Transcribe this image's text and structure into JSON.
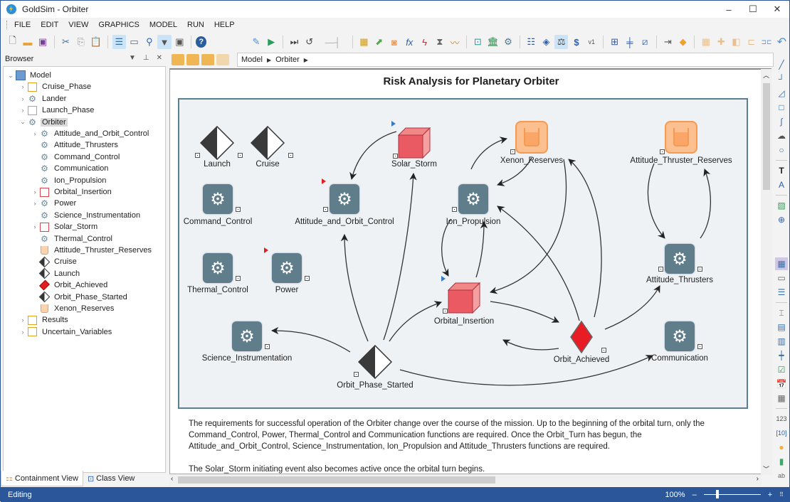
{
  "window": {
    "title": "GoldSim  - Orbiter",
    "controls": {
      "minimize": "–",
      "maximize": "☐",
      "close": "✕"
    }
  },
  "menu": [
    "FILE",
    "EDIT",
    "VIEW",
    "GRAPHICS",
    "MODEL",
    "RUN",
    "HELP"
  ],
  "toolbar": {
    "icons": [
      "new-file-icon",
      "open-folder-icon",
      "save-icon",
      "cut-icon",
      "copy-icon",
      "paste-icon",
      "browser-view-icon",
      "note-icon",
      "find-icon",
      "filter-icon",
      "options-icon",
      "help-icon",
      "edit-mode-icon",
      "run-icon",
      "step-icon",
      "reset-icon",
      "run-speed-slider",
      "container-icon",
      "export-icon",
      "reservoir-icon",
      "function-icon",
      "event-icon",
      "timer-icon",
      "chart-icon",
      "database-icon",
      "library-icon",
      "settings-icon",
      "list-icon",
      "tag-icon",
      "weight-icon",
      "dollar-icon",
      "version-icon",
      "network-icon",
      "align-icon",
      "graph-icon",
      "import-icon",
      "stack-icon",
      "group-icon",
      "ungroup-icon",
      "order-icon",
      "align-left-icon",
      "distribute-icon",
      "undo-icon"
    ]
  },
  "browser": {
    "title": "Browser",
    "tree": [
      {
        "label": "Model",
        "icon": "model",
        "level": 0,
        "expander": "open"
      },
      {
        "label": "Cruise_Phase",
        "icon": "container",
        "level": 1,
        "expander": "closed"
      },
      {
        "label": "Lander",
        "icon": "subsystem",
        "level": 1,
        "expander": "closed"
      },
      {
        "label": "Launch_Phase",
        "icon": "container",
        "level": 1,
        "expander": "closed"
      },
      {
        "label": "Orbiter",
        "icon": "subsystem",
        "level": 1,
        "expander": "open",
        "selected": true
      },
      {
        "label": "Attitude_and_Orbit_Control",
        "icon": "subsystem",
        "level": 2,
        "expander": "closed"
      },
      {
        "label": "Attitude_Thrusters",
        "icon": "subsystem",
        "level": 2,
        "expander": ""
      },
      {
        "label": "Command_Control",
        "icon": "subsystem",
        "level": 2,
        "expander": ""
      },
      {
        "label": "Communication",
        "icon": "subsystem",
        "level": 2,
        "expander": ""
      },
      {
        "label": "Ion_Propulsion",
        "icon": "subsystem",
        "level": 2,
        "expander": ""
      },
      {
        "label": "Orbital_Insertion",
        "icon": "container-red",
        "level": 2,
        "expander": "closed"
      },
      {
        "label": "Power",
        "icon": "subsystem",
        "level": 2,
        "expander": "closed"
      },
      {
        "label": "Science_Instrumentation",
        "icon": "subsystem",
        "level": 2,
        "expander": ""
      },
      {
        "label": "Solar_Storm",
        "icon": "container-red",
        "level": 2,
        "expander": "closed"
      },
      {
        "label": "Thermal_Control",
        "icon": "subsystem",
        "level": 2,
        "expander": ""
      },
      {
        "label": "Attitude_Thruster_Reserves",
        "icon": "reservoir",
        "level": 2,
        "expander": ""
      },
      {
        "label": "Cruise",
        "icon": "event",
        "level": 2,
        "expander": ""
      },
      {
        "label": "Launch",
        "icon": "event",
        "level": 2,
        "expander": ""
      },
      {
        "label": "Orbit_Achieved",
        "icon": "event-red",
        "level": 2,
        "expander": ""
      },
      {
        "label": "Orbit_Phase_Started",
        "icon": "event",
        "level": 2,
        "expander": ""
      },
      {
        "label": "Xenon_Reserves",
        "icon": "reservoir",
        "level": 2,
        "expander": ""
      },
      {
        "label": "Results",
        "icon": "container",
        "level": 1,
        "expander": "closed"
      },
      {
        "label": "Uncertain_Variables",
        "icon": "container",
        "level": 1,
        "expander": "closed"
      }
    ],
    "tabs": [
      {
        "label": "Containment View",
        "active": true
      },
      {
        "label": "Class View",
        "active": false
      }
    ]
  },
  "breadcrumb": [
    "Model",
    "Orbiter"
  ],
  "canvas": {
    "title": "Risk Analysis for Planetary Orbiter",
    "elements": [
      {
        "id": "launch",
        "label": "Launch",
        "type": "event"
      },
      {
        "id": "cruise",
        "label": "Cruise",
        "type": "event"
      },
      {
        "id": "solar_storm",
        "label": "Solar_Storm",
        "type": "initiator"
      },
      {
        "id": "xenon",
        "label": "Xenon_Reserves",
        "type": "reservoir"
      },
      {
        "id": "atr",
        "label": "Attitude_Thruster_Reserves",
        "type": "reservoir"
      },
      {
        "id": "command",
        "label": "Command_Control",
        "type": "subsystem"
      },
      {
        "id": "aoc",
        "label": "Attitude_and_Orbit_Control",
        "type": "subsystem"
      },
      {
        "id": "ion",
        "label": "Ion_Propulsion",
        "type": "subsystem"
      },
      {
        "id": "thermal",
        "label": "Thermal_Control",
        "type": "subsystem"
      },
      {
        "id": "power",
        "label": "Power",
        "type": "subsystem"
      },
      {
        "id": "orbins",
        "label": "Orbital_Insertion",
        "type": "initiator"
      },
      {
        "id": "att_thr",
        "label": "Attitude_Thrusters",
        "type": "subsystem"
      },
      {
        "id": "science",
        "label": "Science_Instrumentation",
        "type": "subsystem"
      },
      {
        "id": "ops",
        "label": "Orbit_Phase_Started",
        "type": "event"
      },
      {
        "id": "oa",
        "label": "Orbit_Achieved",
        "type": "event-red"
      },
      {
        "id": "comm",
        "label": "Communication",
        "type": "subsystem"
      }
    ],
    "description": [
      "The requirements for successful operation of the Orbiter change over the course of the mission.   Up to the beginning of the orbital turn, only the Command_Control, Power, Thermal_Control and Communication functions are required.  Once the Orbit_Turn has begun, the Attitude_and_Orbit_Control, Science_Instrumentation, Ion_Propulsion and Attitude_Thrusters functions are required.",
      "The Solar_Storm initiating event also becomes active once the orbital turn begins."
    ]
  },
  "status": {
    "mode": "Editing",
    "zoom": "100%",
    "zoom_minus": "–",
    "zoom_plus": "+"
  }
}
